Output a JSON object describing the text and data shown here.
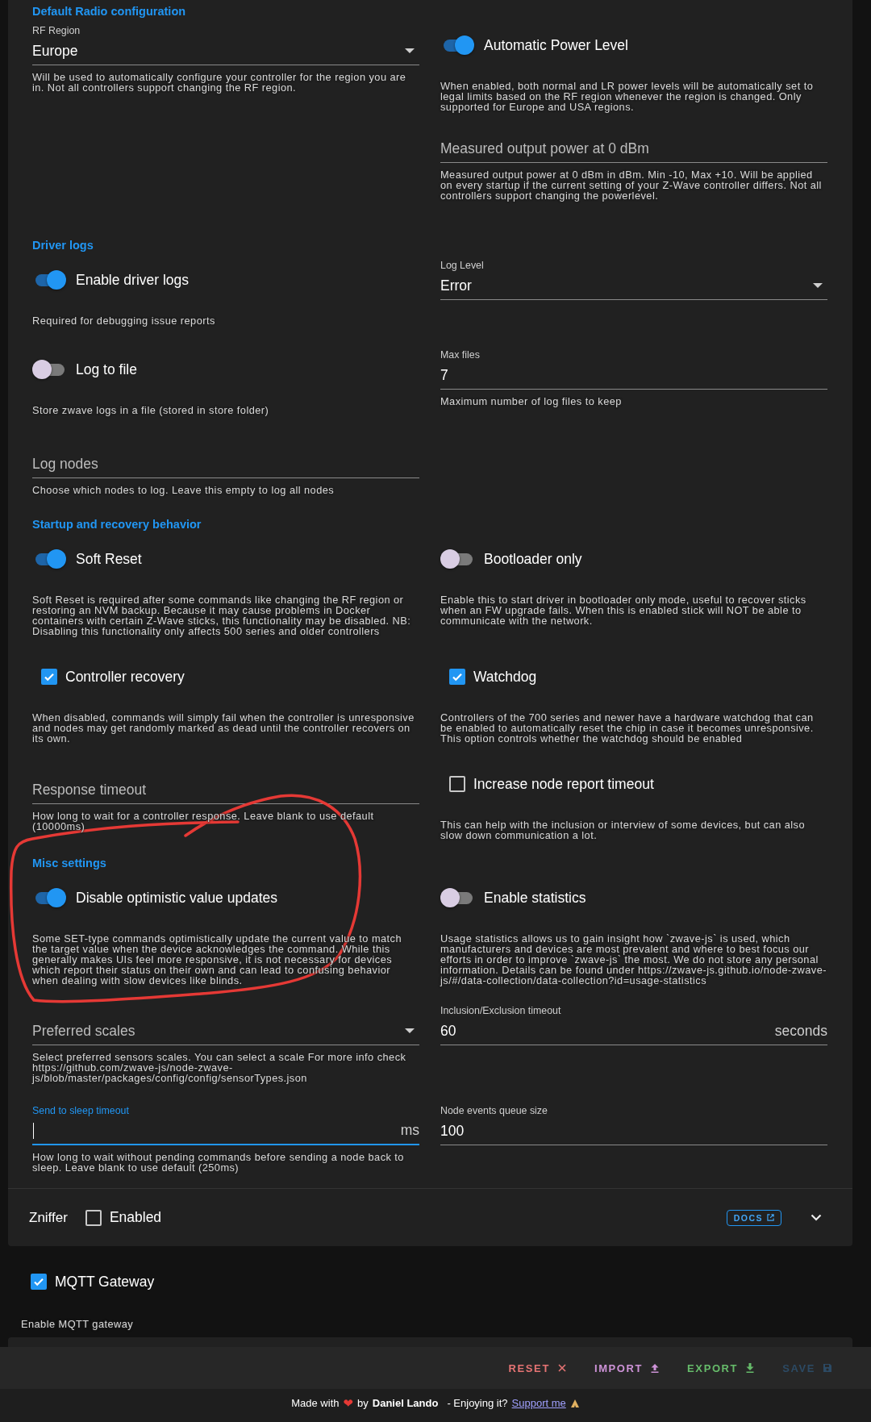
{
  "sections": [
    {
      "title": "Default Radio configuration",
      "rows": [
        {
          "left": [
            {
              "kind": "select",
              "label": "RF Region",
              "value": "Europe",
              "hint": "Will be used to automatically configure your controller for the region you are in. Not all controllers support changing the RF region."
            }
          ],
          "right": [
            {
              "kind": "toggle",
              "label": "Automatic Power Level",
              "on": true,
              "hint": "When enabled, both normal and LR power levels will be automatically set to legal limits based on the RF region whenever the region is changed. Only supported for Europe and USA regions."
            },
            {
              "kind": "field",
              "placeholder": "Measured output power at 0 dBm",
              "hint": "Measured output power at 0 dBm in dBm. Min -10, Max +10. Will be applied on every startup if the current setting of your Z-Wave controller differs. Not all controllers support changing the powerlevel."
            }
          ]
        }
      ]
    },
    {
      "title": "Driver logs",
      "rows": [
        {
          "left": [
            {
              "kind": "toggle",
              "label": "Enable driver logs",
              "on": true,
              "hint": "Required for debugging issue reports"
            }
          ],
          "right": [
            {
              "kind": "select",
              "label": "Log Level",
              "value": "Error"
            }
          ]
        },
        {
          "left": [
            {
              "kind": "toggle",
              "label": "Log to file",
              "on": false,
              "hint": "Store zwave logs in a file (stored in store folder)"
            }
          ],
          "right": [
            {
              "kind": "field",
              "label": "Max files",
              "value": "7",
              "hint": "Maximum number of log files to keep"
            }
          ]
        },
        {
          "left": [
            {
              "kind": "field",
              "placeholder": "Log nodes",
              "hint": "Choose which nodes to log. Leave this empty to log all nodes"
            }
          ],
          "right": []
        }
      ]
    },
    {
      "title": "Startup and recovery behavior",
      "rows": [
        {
          "left": [
            {
              "kind": "toggle",
              "label": "Soft Reset",
              "on": true,
              "hint": "Soft Reset is required after some commands like changing the RF region or restoring an NVM backup. Because it may cause problems in Docker containers with certain Z-Wave sticks, this functionality may be disabled. NB: Disabling this functionality only affects 500 series and older controllers"
            }
          ],
          "right": [
            {
              "kind": "toggle",
              "label": "Bootloader only",
              "on": false,
              "hint": "Enable this to start driver in bootloader only mode, useful to recover sticks when an FW upgrade fails. When this is enabled stick will NOT be able to communicate with the network."
            }
          ]
        },
        {
          "left": [
            {
              "kind": "checkbox",
              "label": "Controller recovery",
              "checked": true,
              "hint": "When disabled, commands will simply fail when the controller is unresponsive and nodes may get randomly marked as dead until the controller recovers on its own."
            }
          ],
          "right": [
            {
              "kind": "checkbox",
              "label": "Watchdog",
              "checked": true,
              "hint": "Controllers of the 700 series and newer have a hardware watchdog that can be enabled to automatically reset the chip in case it becomes unresponsive. This option controls whether the watchdog should be enabled"
            }
          ]
        },
        {
          "left": [
            {
              "kind": "field",
              "placeholder": "Response timeout",
              "hint": "How long to wait for a controller response. Leave blank to use default (10000ms)"
            }
          ],
          "right": [
            {
              "kind": "checkbox",
              "label": "Increase node report timeout",
              "checked": false,
              "hint": "This can help with the inclusion or interview of some devices, but can also slow down communication a lot."
            }
          ]
        }
      ]
    },
    {
      "title": "Misc settings",
      "rows": [
        {
          "left": [
            {
              "kind": "toggle",
              "label": "Disable optimistic value updates",
              "on": true,
              "hint": "Some SET-type commands optimistically update the current value to match the target value when the device acknowledges the command. While this generally makes UIs feel more responsive, it is not necessary for devices which report their status on their own and can lead to confusing behavior when dealing with slow devices like blinds."
            }
          ],
          "right": [
            {
              "kind": "toggle",
              "label": "Enable statistics",
              "on": false,
              "hint": "Usage statistics allows us to gain insight how `zwave-js` is used, which manufacturers and devices are most prevalent and where to best focus our efforts in order to improve `zwave-js` the most. We do not store any personal information. Details can be found under https://zwave-js.github.io/node-zwave-js/#/data-collection/data-collection?id=usage-statistics"
            }
          ]
        },
        {
          "left": [
            {
              "kind": "select",
              "placeholder": "Preferred scales",
              "hint": "Select preferred sensors scales. You can select a scale For more info check https://github.com/zwave-js/node-zwave-js/blob/master/packages/config/config/sensorTypes.json"
            }
          ],
          "right": [
            {
              "kind": "field",
              "label": "Inclusion/Exclusion timeout",
              "value": "60",
              "suffix": "seconds"
            }
          ]
        },
        {
          "left": [
            {
              "kind": "field",
              "label": "Send to sleep timeout",
              "suffix": "ms",
              "focused": true,
              "hint": "How long to wait without pending commands before sending a node back to sleep. Leave blank to use default (250ms)"
            }
          ],
          "right": [
            {
              "kind": "field",
              "label": "Node events queue size",
              "value": "100"
            }
          ]
        }
      ]
    }
  ],
  "zniffer": {
    "title": "Zniffer",
    "enabled_label": "Enabled",
    "enabled": false,
    "docs_button": "DOCS",
    "expanded": false
  },
  "mqtt": {
    "label": "MQTT Gateway",
    "checked": true,
    "hint": "Enable MQTT gateway"
  },
  "actions": [
    {
      "label": "RESET",
      "kind": "reset",
      "disabled": false
    },
    {
      "label": "IMPORT",
      "kind": "import",
      "disabled": false
    },
    {
      "label": "EXPORT",
      "kind": "export",
      "disabled": false
    },
    {
      "label": "SAVE",
      "kind": "save",
      "disabled": true
    }
  ],
  "footer": {
    "made_with": "Made with",
    "heart": "❤",
    "by": "by",
    "author": "Daniel Lando",
    "enjoying": "- Enjoying it?",
    "support_link": "Support me"
  },
  "annotation": {
    "kind": "freehand-circle"
  }
}
